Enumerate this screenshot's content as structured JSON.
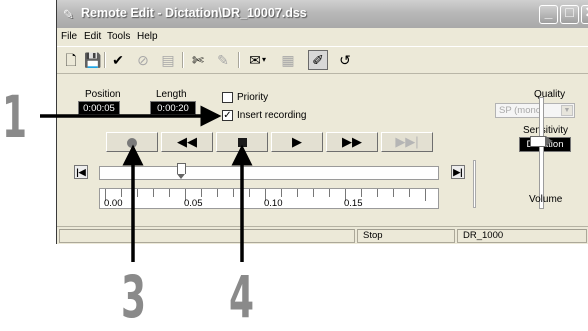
{
  "window": {
    "title": "Remote Edit - Dictation\\DR_10007.dss"
  },
  "menu": [
    "File",
    "Edit",
    "Tools",
    "Help"
  ],
  "toolbar": {
    "icons": [
      "new-file-icon",
      "save-icon",
      "checkmark-icon",
      "cancel-icon",
      "properties-icon",
      "cut-icon",
      "paste-icon",
      "dictate-icon",
      "speech-icon",
      "settings-icon",
      "undo-icon"
    ]
  },
  "position": {
    "label": "Position",
    "value": "0:00:05"
  },
  "length": {
    "label": "Length",
    "value": "0:00:20"
  },
  "options": {
    "priority": {
      "label": "Priority",
      "checked": false
    },
    "insert": {
      "label": "Insert recording",
      "checked": true
    }
  },
  "quality": {
    "label": "Quality",
    "value": "SP (mono)"
  },
  "sensitivity": {
    "label": "Sensitivity",
    "value": "Dictation"
  },
  "volume": {
    "label": "Volume"
  },
  "scale": {
    "ticks": [
      "0.00",
      "0.05",
      "0.10",
      "0.15"
    ]
  },
  "status": {
    "state": "Stop",
    "author": "DR_1000"
  },
  "callouts": [
    "1",
    "3",
    "4"
  ]
}
